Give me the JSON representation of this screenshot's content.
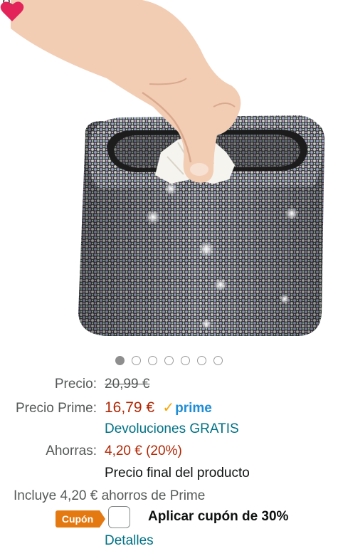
{
  "product": {
    "image_description_icon": "product-photo",
    "carousel": {
      "total": 7,
      "active_index": 0
    }
  },
  "price": {
    "list_label": "Precio:",
    "list_value": "20,99 €",
    "prime_label": "Precio Prime:",
    "prime_value": "16,79 €",
    "prime_brand": "prime",
    "returns_link": "Devoluciones GRATIS",
    "savings_label": "Ahorras:",
    "savings_value": "4,20 € (20%)",
    "final_note": "Precio final del producto",
    "includes_note": "Incluye 4,20 € ahorros de Prime"
  },
  "coupon": {
    "badge": "Cupón",
    "apply_label": "Aplicar cupón de 30%",
    "details_link": "Detalles",
    "checked": false
  },
  "colors": {
    "price_red": "#B12704",
    "link_teal": "#007185",
    "prime_blue": "#1F8DD6",
    "coupon_orange": "#E47911",
    "wishlist_pink": "#E3245B"
  }
}
